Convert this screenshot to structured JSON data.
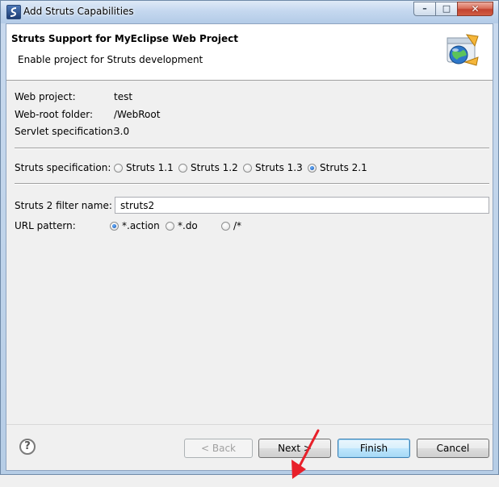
{
  "window": {
    "title": "Add Struts Capabilities",
    "controls": {
      "minimize": "–",
      "maximize": "□",
      "close": "✕"
    }
  },
  "header": {
    "title": "Struts Support for MyEclipse Web Project",
    "subtitle": "Enable project for Struts development",
    "icon": "struts-globe-wizard-icon"
  },
  "project": {
    "web_project_label": "Web project:",
    "web_project_value": "test",
    "web_root_label": "Web-root folder:",
    "web_root_value": "/WebRoot",
    "servlet_label": "Servlet specification:",
    "servlet_value": "3.0"
  },
  "struts_spec": {
    "label": "Struts specification:",
    "options": [
      "Struts 1.1",
      "Struts 1.2",
      "Struts 1.3",
      "Struts 2.1"
    ],
    "selected": "Struts 2.1"
  },
  "filter": {
    "label": "Struts 2 filter name:",
    "value": "struts2"
  },
  "url_pattern": {
    "label": "URL pattern:",
    "options": [
      "*.action",
      "*.do",
      "/*"
    ],
    "selected": "*.action"
  },
  "buttons": {
    "help": "?",
    "back": "< Back",
    "next": "Next >",
    "finish": "Finish",
    "cancel": "Cancel"
  },
  "colors": {
    "annotation_arrow": "#e8202a",
    "default_button_border": "#3c7fb1"
  }
}
